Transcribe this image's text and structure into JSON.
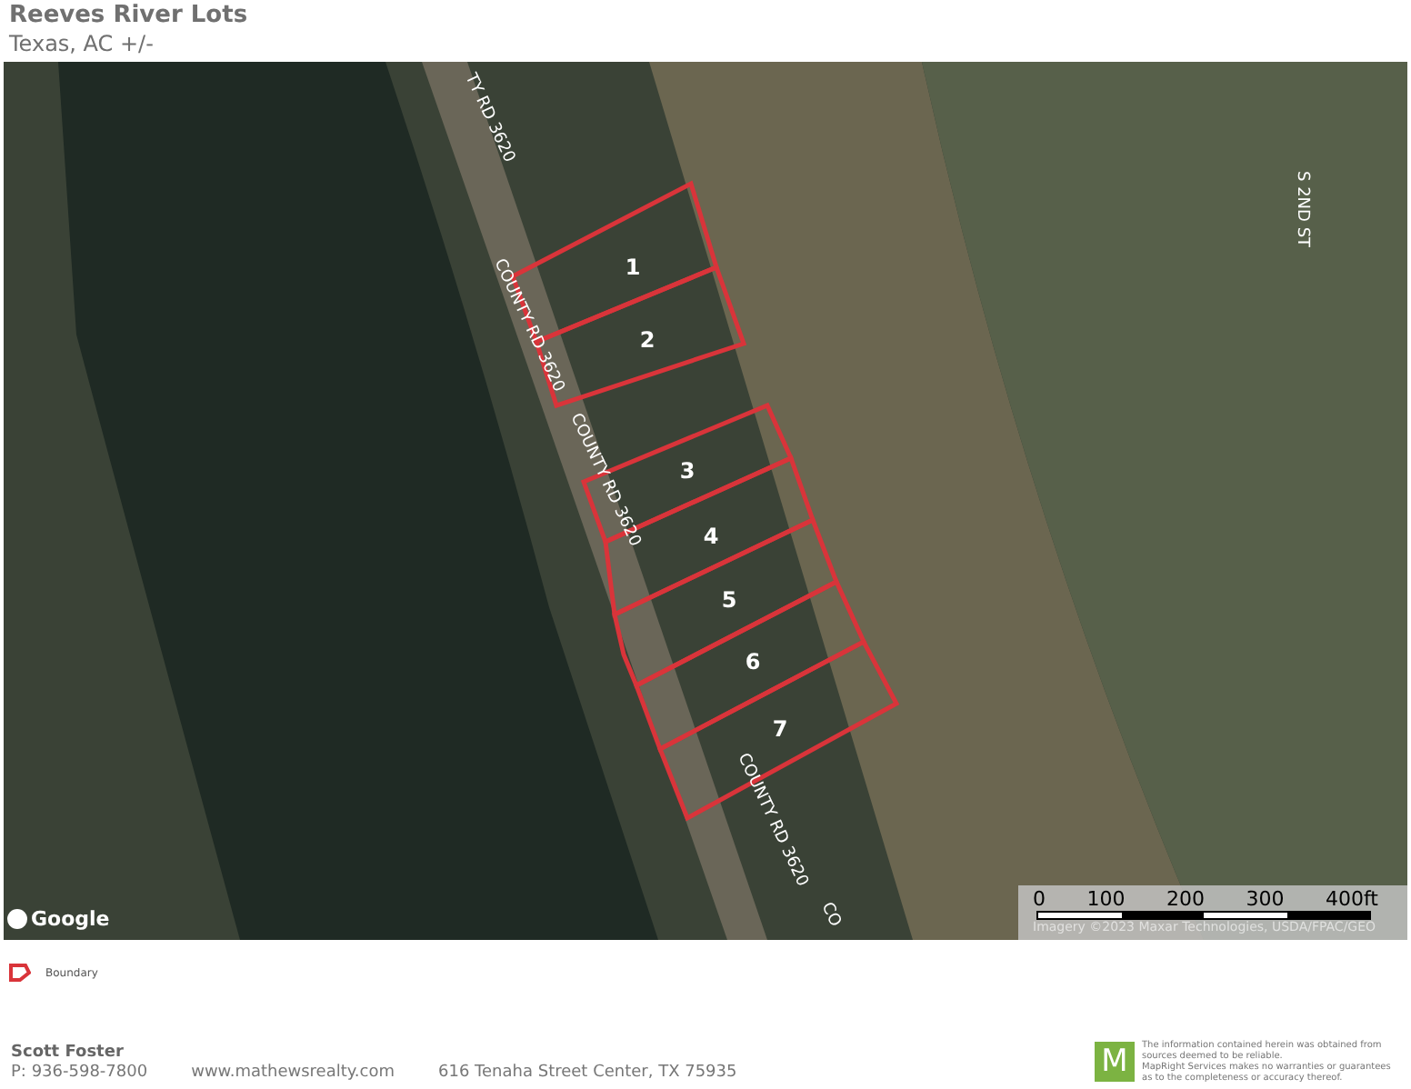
{
  "header": {
    "title": "Reeves River Lots",
    "subtitle": "Texas,  AC +/-"
  },
  "map": {
    "lots": [
      {
        "label": "1"
      },
      {
        "label": "2"
      },
      {
        "label": "3"
      },
      {
        "label": "4"
      },
      {
        "label": "5"
      },
      {
        "label": "6"
      },
      {
        "label": "7"
      }
    ],
    "road_labels": [
      "TY RD 3620",
      "COUNTY RD 3620",
      "COUNTY RD 3620",
      "COUNTY RD 3620",
      "CO",
      "S 2ND ST"
    ],
    "scale": {
      "ticks": [
        "0",
        "100",
        "200",
        "300",
        "400ft"
      ]
    },
    "attribution": "Imagery ©2023 Maxar Technologies, USDA/FPAC/GEO",
    "logo": "Google"
  },
  "legend": [
    {
      "label": "Boundary",
      "color": "#d9343a"
    }
  ],
  "footer": {
    "name": "Scott Foster",
    "phone": "P: 936-598-7800",
    "website": "www.mathewsrealty.com",
    "address": "616 Tenaha Street Center, TX 75935",
    "logo_letter": "M",
    "disclaimer": "The information contained herein was obtained from sources deemed to be reliable.\n MapRight Services makes no warranties or guarantees as to the completeness or accuracy thereof."
  }
}
